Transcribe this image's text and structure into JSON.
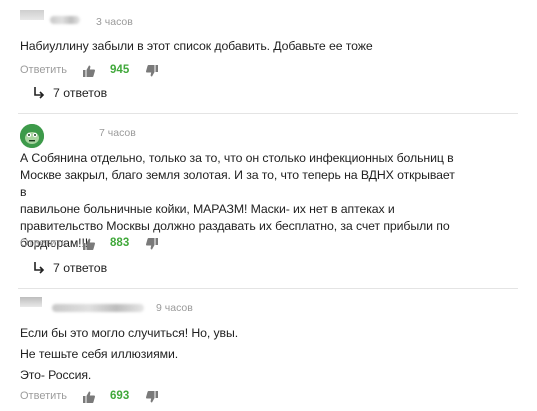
{
  "comments": [
    {
      "time": "3 часов",
      "lines": [
        "Набиуллину забыли в этот список добавить. Добавьте ее тоже"
      ],
      "reply_label": "Ответить",
      "likes": "945",
      "replies_label": "7 ответов"
    },
    {
      "time": "7 часов",
      "lines": [
        "А Собянина отдельно, только за то, что он столько инфекционных больниц в",
        "Москве закрыл, благо земля золотая. И за то, что теперь на ВДНХ открывает в",
        "павильоне больничные койки, МАРАЗМ! Маски- их нет в аптеках и",
        "правительство Москвы должно раздавать их бесплатно, за счет прибыли по",
        "бордюрам!!!"
      ],
      "reply_label": "Ответить",
      "likes": "883",
      "replies_label": "7 ответов"
    },
    {
      "time": "9 часов",
      "lines": [
        "Если бы это могло случиться! Но, увы.",
        "Не тешьте себя иллюзиями.",
        "Это- Россия."
      ],
      "reply_label": "Ответить",
      "likes": "693"
    }
  ],
  "colors": {
    "likes_green": "#40a83a",
    "muted_gray": "#9c9c9c",
    "avatar_green": "#3d9a4a"
  },
  "icons": {
    "like": "thumbs-up-icon",
    "dislike": "thumbs-down-icon",
    "replies": "reply-arrow-icon"
  }
}
